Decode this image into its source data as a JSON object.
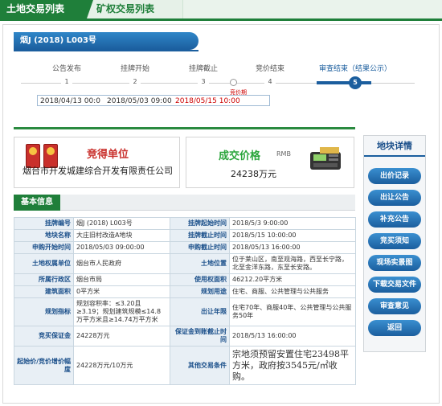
{
  "tabs": [
    "土地交易列表",
    "矿权交易列表"
  ],
  "listing_code": "烟J (2018) L003号",
  "progress": {
    "steps": [
      {
        "label": "公告发布",
        "num": "1"
      },
      {
        "label": "挂牌开始",
        "num": "2"
      },
      {
        "label": "挂牌截止",
        "num": "3"
      },
      {
        "label": "竞价结束",
        "num": "4"
      },
      {
        "label": "审查结束（结果公示）",
        "num": "5"
      }
    ],
    "dates": [
      "2018/04/13 00:0",
      "2018/05/03 09:00",
      "2018/05/15 10:00"
    ],
    "bid_period_label": "竞价期"
  },
  "result": {
    "winner_title": "竞得单位",
    "winner_name": "烟台市开发城建综合开发有限责任公司",
    "price_title": "成交价格",
    "price_unit": "RMB",
    "price_value": "24238万元"
  },
  "info_header": "基本信息",
  "info_rows": [
    [
      "挂牌编号",
      "烟J (2018) L003号",
      "挂牌起始时间",
      "2018/5/3 9:00:00"
    ],
    [
      "地块名称",
      "大庄旧村改造A地块",
      "挂牌截止时间",
      "2018/5/15 10:00:00"
    ],
    [
      "申购开始时间",
      "2018/05/03 09:00:00",
      "申购截止时间",
      "2018/05/13 16:00:00"
    ],
    [
      "土地权属单位",
      "烟台市人民政府",
      "土地位置",
      "位于莱山区，南至观海路，西至长宁路，北至金洋东路，东至长安路。"
    ],
    [
      "所属行政区",
      "烟台市局",
      "使用权面积",
      "46212.20平方米"
    ],
    [
      "建筑面积",
      "0平方米",
      "规划用途",
      "住宅、商服、公共管理与公共服务"
    ],
    [
      "规划指标",
      "规划容积率：≤3.20且≥3.19；规划建筑规模≤14.8万平方米且≥14.74万平方米",
      "出让年限",
      "住宅70年、商服40年、公共管理与公共服务50年"
    ],
    [
      "竞买保证金",
      "24228万元",
      "保证金到账截止时间",
      "2018/5/13 16:00:00"
    ],
    [
      "起始价/竞价增价幅度",
      "24228万元/10万元",
      "其他交易条件",
      "宗地须预留安置住宅23498平方米，政府按3545元/㎡收购。"
    ]
  ],
  "sidebar": {
    "title": "地块详情",
    "buttons": [
      "出价记录",
      "出让公告",
      "补充公告",
      "竞买须知",
      "现场实景图",
      "下载交易文件",
      "审查意见",
      "返回"
    ]
  }
}
